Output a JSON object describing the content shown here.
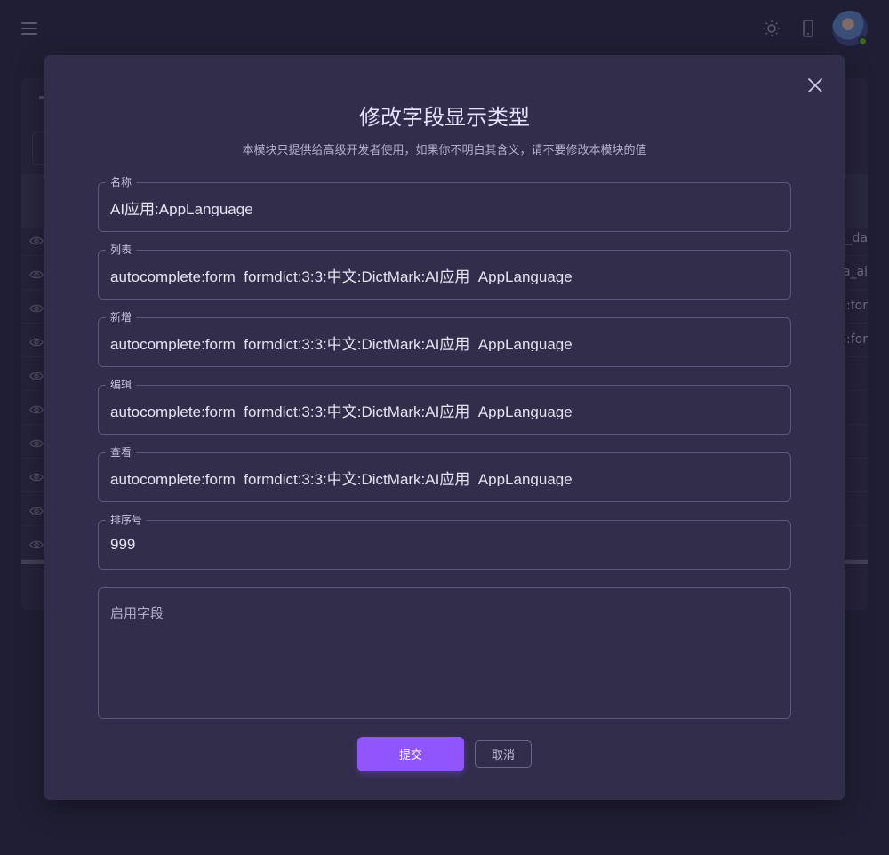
{
  "background": {
    "table_cells": [
      "a_da",
      "a_ai",
      "e:for",
      "e:for"
    ],
    "row_count": 10
  },
  "dialog": {
    "title": "修改字段显示类型",
    "subtitle": "本模块只提供给高级开发者使用，如果你不明白其含义，请不要修改本模块的值",
    "fields": [
      {
        "label": "名称",
        "value": "AI应用:AppLanguage"
      },
      {
        "label": "列表",
        "value": "autocomplete:form_formdict:3:3:中文:DictMark:AI应用_AppLanguage"
      },
      {
        "label": "新增",
        "value": "autocomplete:form_formdict:3:3:中文:DictMark:AI应用_AppLanguage"
      },
      {
        "label": "编辑",
        "value": "autocomplete:form_formdict:3:3:中文:DictMark:AI应用_AppLanguage"
      },
      {
        "label": "查看",
        "value": "autocomplete:form_formdict:3:3:中文:DictMark:AI应用_AppLanguage"
      },
      {
        "label": "排序号",
        "value": "999"
      }
    ],
    "textarea_placeholder": "启用字段",
    "submit_label": "提交",
    "cancel_label": "取消"
  },
  "colors": {
    "accent": "#9155fd",
    "dialog_bg": "#312d4b",
    "page_bg": "#25223a",
    "online_status": "#56ca00"
  },
  "icons": [
    "menu-icon",
    "brightness-icon",
    "mobile-icon",
    "close-icon",
    "eye-icon"
  ]
}
